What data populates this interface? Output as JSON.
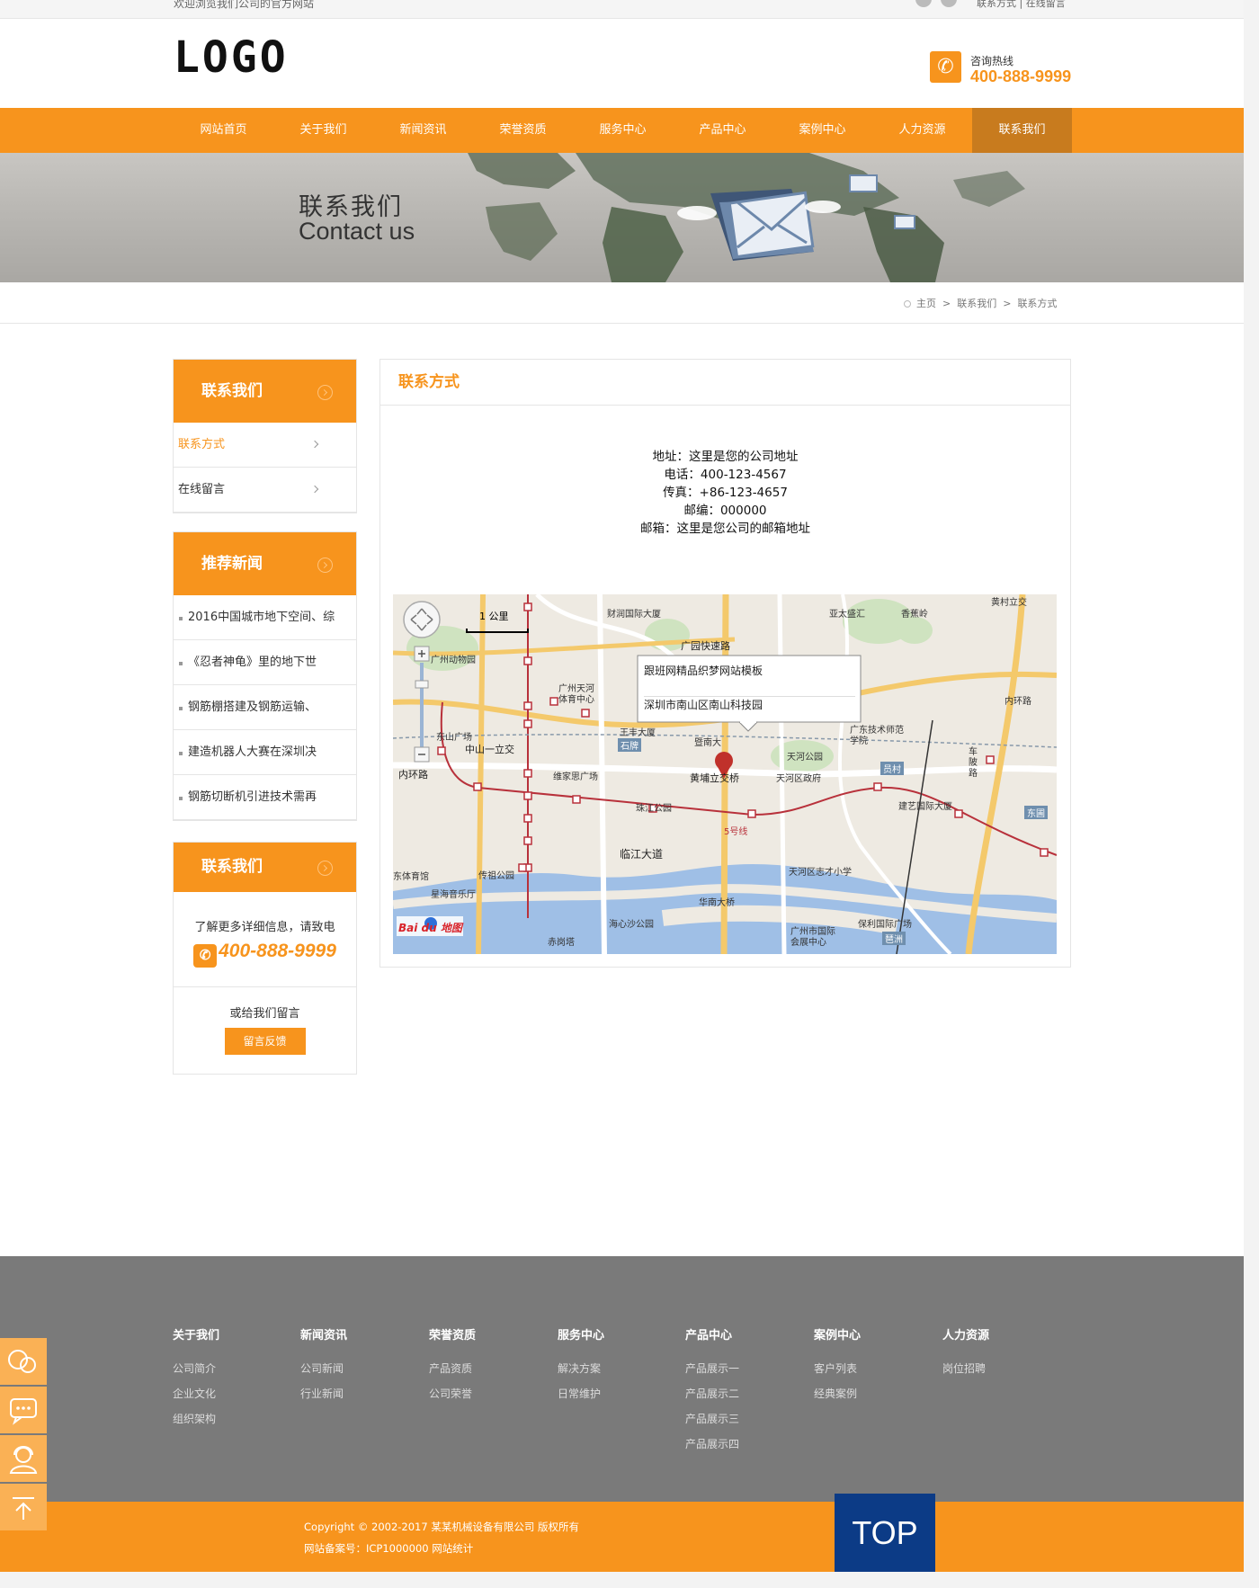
{
  "topbar": {
    "welcome": "欢迎浏览我们公司的官方网站",
    "links": "联系方式 | 在线留言"
  },
  "header": {
    "logo": "LOGO",
    "hotline_label": "咨询热线",
    "hotline_number": "400-888-9999"
  },
  "nav": {
    "items": [
      "网站首页",
      "关于我们",
      "新闻资讯",
      "荣誉资质",
      "服务中心",
      "产品中心",
      "案例中心",
      "人力资源",
      "联系我们"
    ]
  },
  "banner": {
    "title_zh": "联系我们",
    "title_en": "Contact us"
  },
  "breadcrumb": {
    "home": "主页",
    "level1": "联系我们",
    "level2": "联系方式",
    "separator": ">"
  },
  "sidebar": {
    "contact_head": "联系我们",
    "contact_items": [
      "联系方式",
      "在线留言"
    ],
    "news_head": "推荐新闻",
    "news_items": [
      "2016中国城市地下空间、综",
      "《忍者神龟》里的地下世",
      "钢筋棚搭建及钢筋运输、",
      "建造机器人大赛在深圳决",
      "钢筋切断机引进技术需再"
    ],
    "contact2_head": "联系我们",
    "contact2_text": "了解更多详细信息，请致电",
    "contact2_phone": "400-888-9999",
    "msg_text": "或给我们留言",
    "msg_button": "留言反馈"
  },
  "main": {
    "title": "联系方式",
    "address": "地址：这里是您的公司地址",
    "phone": "电话：400-123-4567",
    "fax": "传真：+86-123-4657",
    "postcode": "邮编：000000",
    "email": "邮箱：这里是您公司的邮箱地址",
    "map": {
      "scale": "1 公里",
      "popup_title": "跟班网精品织梦网站模板",
      "popup_addr": "深圳市南山区南山科技园",
      "brand": "Bai du 地图",
      "labels": [
        "财润国际大厦",
        "亚太盛汇",
        "香蕉岭",
        "黄村立交",
        "广园快速路",
        "广州动物园",
        "广州天河体育中心",
        "东山广场",
        "中山一立交",
        "内环路",
        "王丰大厦",
        "石牌",
        "暨南大",
        "黄埔立交桥",
        "天河区政府",
        "天河公园",
        "广东技术师范学院",
        "维家思广场",
        "珠江公园",
        "建艺国际大厦",
        "5号线",
        "临江大道",
        "东体育馆",
        "星海音乐厅",
        "华南大桥",
        "天河区志才小学",
        "海心沙公园",
        "保利国际广场",
        "广州市国际会展中心",
        "赤岗塔",
        "车陂路",
        "东圃",
        "员村",
        "琶洲",
        "传祖公园",
        "内环路"
      ]
    }
  },
  "footer": {
    "cols": [
      {
        "title": "关于我们",
        "links": [
          "公司简介",
          "企业文化",
          "组织架构"
        ]
      },
      {
        "title": "新闻资讯",
        "links": [
          "公司新闻",
          "行业新闻"
        ]
      },
      {
        "title": "荣誉资质",
        "links": [
          "产品资质",
          "公司荣誉"
        ]
      },
      {
        "title": "服务中心",
        "links": [
          "解决方案",
          "日常维护"
        ]
      },
      {
        "title": "产品中心",
        "links": [
          "产品展示一",
          "产品展示二",
          "产品展示三",
          "产品展示四"
        ]
      },
      {
        "title": "案例中心",
        "links": [
          "客户列表",
          "经典案例"
        ]
      },
      {
        "title": "人力资源",
        "links": [
          "岗位招聘"
        ]
      }
    ],
    "copyright": "Copyright © 2002-2017 某某机械设备有限公司 版权所有",
    "icp": "网站备案号：ICP1000000  网站统计",
    "top": "TOP"
  },
  "colors": {
    "accent": "#f7941d",
    "footer_bg": "#7a7a7a",
    "top_button": "#0c3b86"
  }
}
